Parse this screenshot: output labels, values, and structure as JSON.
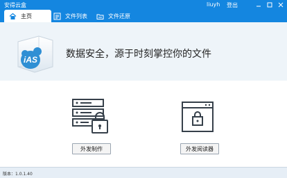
{
  "window": {
    "title": "安得云盒",
    "user": "liuyh",
    "logout_label": "登出"
  },
  "tabs": [
    {
      "label": "主页",
      "icon": "home-icon",
      "active": true
    },
    {
      "label": "文件列表",
      "icon": "file-list-icon",
      "active": false
    },
    {
      "label": "文件还原",
      "icon": "folder-restore-icon",
      "active": false
    }
  ],
  "banner": {
    "logo_text": "iAS",
    "tagline": "数据安全，源于时刻掌控你的文件"
  },
  "actions": [
    {
      "label": "外发制作",
      "icon": "server-lock-icon"
    },
    {
      "label": "外发阅读器",
      "icon": "window-lock-icon"
    }
  ],
  "status": {
    "version_text": "版本：1.0.1.40"
  },
  "colors": {
    "accent": "#1486e0",
    "icon_stroke": "#36404a",
    "banner_bg": "#eef4f9"
  }
}
